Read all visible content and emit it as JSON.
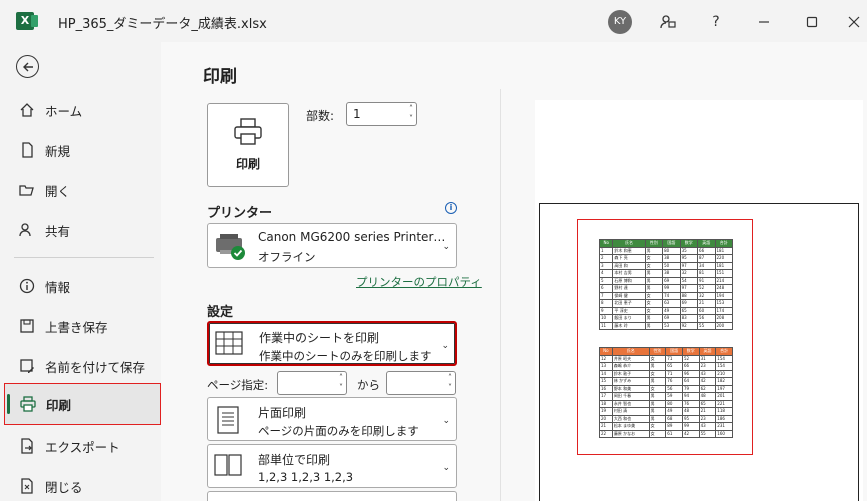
{
  "titlebar": {
    "app_icon": "excel-icon",
    "filename": "HP_365_ダミーデータ_成績表.xlsx",
    "avatar": "KY",
    "icons": [
      "feedback-icon",
      "help-icon",
      "minimize-icon",
      "maximize-icon",
      "close-icon"
    ],
    "help_glyph": "?"
  },
  "nav": {
    "items": [
      {
        "label": "ホーム",
        "icon": "home-icon"
      },
      {
        "label": "新規",
        "icon": "new-document-icon"
      },
      {
        "label": "開く",
        "icon": "folder-open-icon"
      },
      {
        "label": "共有",
        "icon": "share-icon"
      },
      {
        "label": "情報",
        "icon": "info-icon"
      },
      {
        "label": "上書き保存",
        "icon": "save-icon"
      },
      {
        "label": "名前を付けて保存",
        "icon": "save-as-icon"
      },
      {
        "label": "印刷",
        "icon": "printer-icon",
        "active": true
      },
      {
        "label": "エクスポート",
        "icon": "export-icon"
      },
      {
        "label": "閉じる",
        "icon": "close-file-icon"
      }
    ]
  },
  "print": {
    "title": "印刷",
    "button_label": "印刷",
    "copies_label": "部数:",
    "copies_value": "1",
    "printer_section": "プリンター",
    "printer_name": "Canon MG6200 series Printer…",
    "printer_status": "オフライン",
    "printer_properties": "プリンターのプロパティ",
    "settings_section": "設定",
    "settings": [
      {
        "line1": "作業中のシートを印刷",
        "line2": "作業中のシートのみを印刷します",
        "icon": "sheet-grid-icon"
      },
      {
        "line1": "片面印刷",
        "line2": "ページの片面のみを印刷します",
        "icon": "one-sided-icon"
      },
      {
        "line1": "部単位で印刷",
        "line2": "1,2,3    1,2,3    1,2,3",
        "icon": "collated-icon"
      }
    ],
    "pages_label": "ページ指定:",
    "pages_to": "から"
  },
  "preview": {
    "table1_header": [
      "No",
      "氏名",
      "性別",
      "国語",
      "数学",
      "英語",
      "合計"
    ],
    "table1_rows": [
      [
        "1",
        "鈴木 和恵",
        "男",
        "80",
        "35",
        "66",
        "181"
      ],
      [
        "2",
        "森下 亮",
        "女",
        "38",
        "95",
        "87",
        "220"
      ],
      [
        "3",
        "高田 和",
        "女",
        "50",
        "97",
        "34",
        "181"
      ],
      [
        "4",
        "本村 吉男",
        "男",
        "38",
        "32",
        "81",
        "151"
      ],
      [
        "5",
        "石原 博和",
        "男",
        "69",
        "54",
        "91",
        "214"
      ],
      [
        "6",
        "野村 達",
        "男",
        "99",
        "97",
        "52",
        "248"
      ],
      [
        "7",
        "保崎 健",
        "女",
        "74",
        "88",
        "32",
        "194"
      ],
      [
        "8",
        "北田 恵子",
        "女",
        "63",
        "69",
        "21",
        "153"
      ],
      [
        "9",
        "平 淳史",
        "女",
        "49",
        "65",
        "60",
        "174"
      ],
      [
        "10",
        "飯田 まり",
        "男",
        "69",
        "83",
        "56",
        "208"
      ],
      [
        "11",
        "藤木 玲",
        "男",
        "53",
        "92",
        "55",
        "200"
      ]
    ],
    "table2_header": [
      "No",
      "氏名",
      "性別",
      "国語",
      "数学",
      "英語",
      "合計"
    ],
    "table2_rows": [
      [
        "12",
        "井原 昭夫",
        "女",
        "71",
        "52",
        "31",
        "154"
      ],
      [
        "13",
        "森嶋 恭介",
        "男",
        "65",
        "66",
        "23",
        "154"
      ],
      [
        "14",
        "鈴木 敦子",
        "女",
        "71",
        "96",
        "43",
        "210"
      ],
      [
        "15",
        "林 かずみ",
        "男",
        "76",
        "64",
        "42",
        "182"
      ],
      [
        "16",
        "野本 和美",
        "女",
        "56",
        "79",
        "62",
        "197"
      ],
      [
        "17",
        "岡田 千春",
        "男",
        "59",
        "94",
        "48",
        "201"
      ],
      [
        "18",
        "永井 智也",
        "男",
        "80",
        "76",
        "65",
        "221"
      ],
      [
        "19",
        "村田 清",
        "男",
        "49",
        "48",
        "21",
        "118"
      ],
      [
        "20",
        "大西 和也",
        "男",
        "68",
        "95",
        "23",
        "186"
      ],
      [
        "21",
        "松本 まゆ美",
        "女",
        "89",
        "99",
        "43",
        "231"
      ],
      [
        "22",
        "藤原 かなお",
        "女",
        "61",
        "42",
        "55",
        "160"
      ]
    ]
  }
}
